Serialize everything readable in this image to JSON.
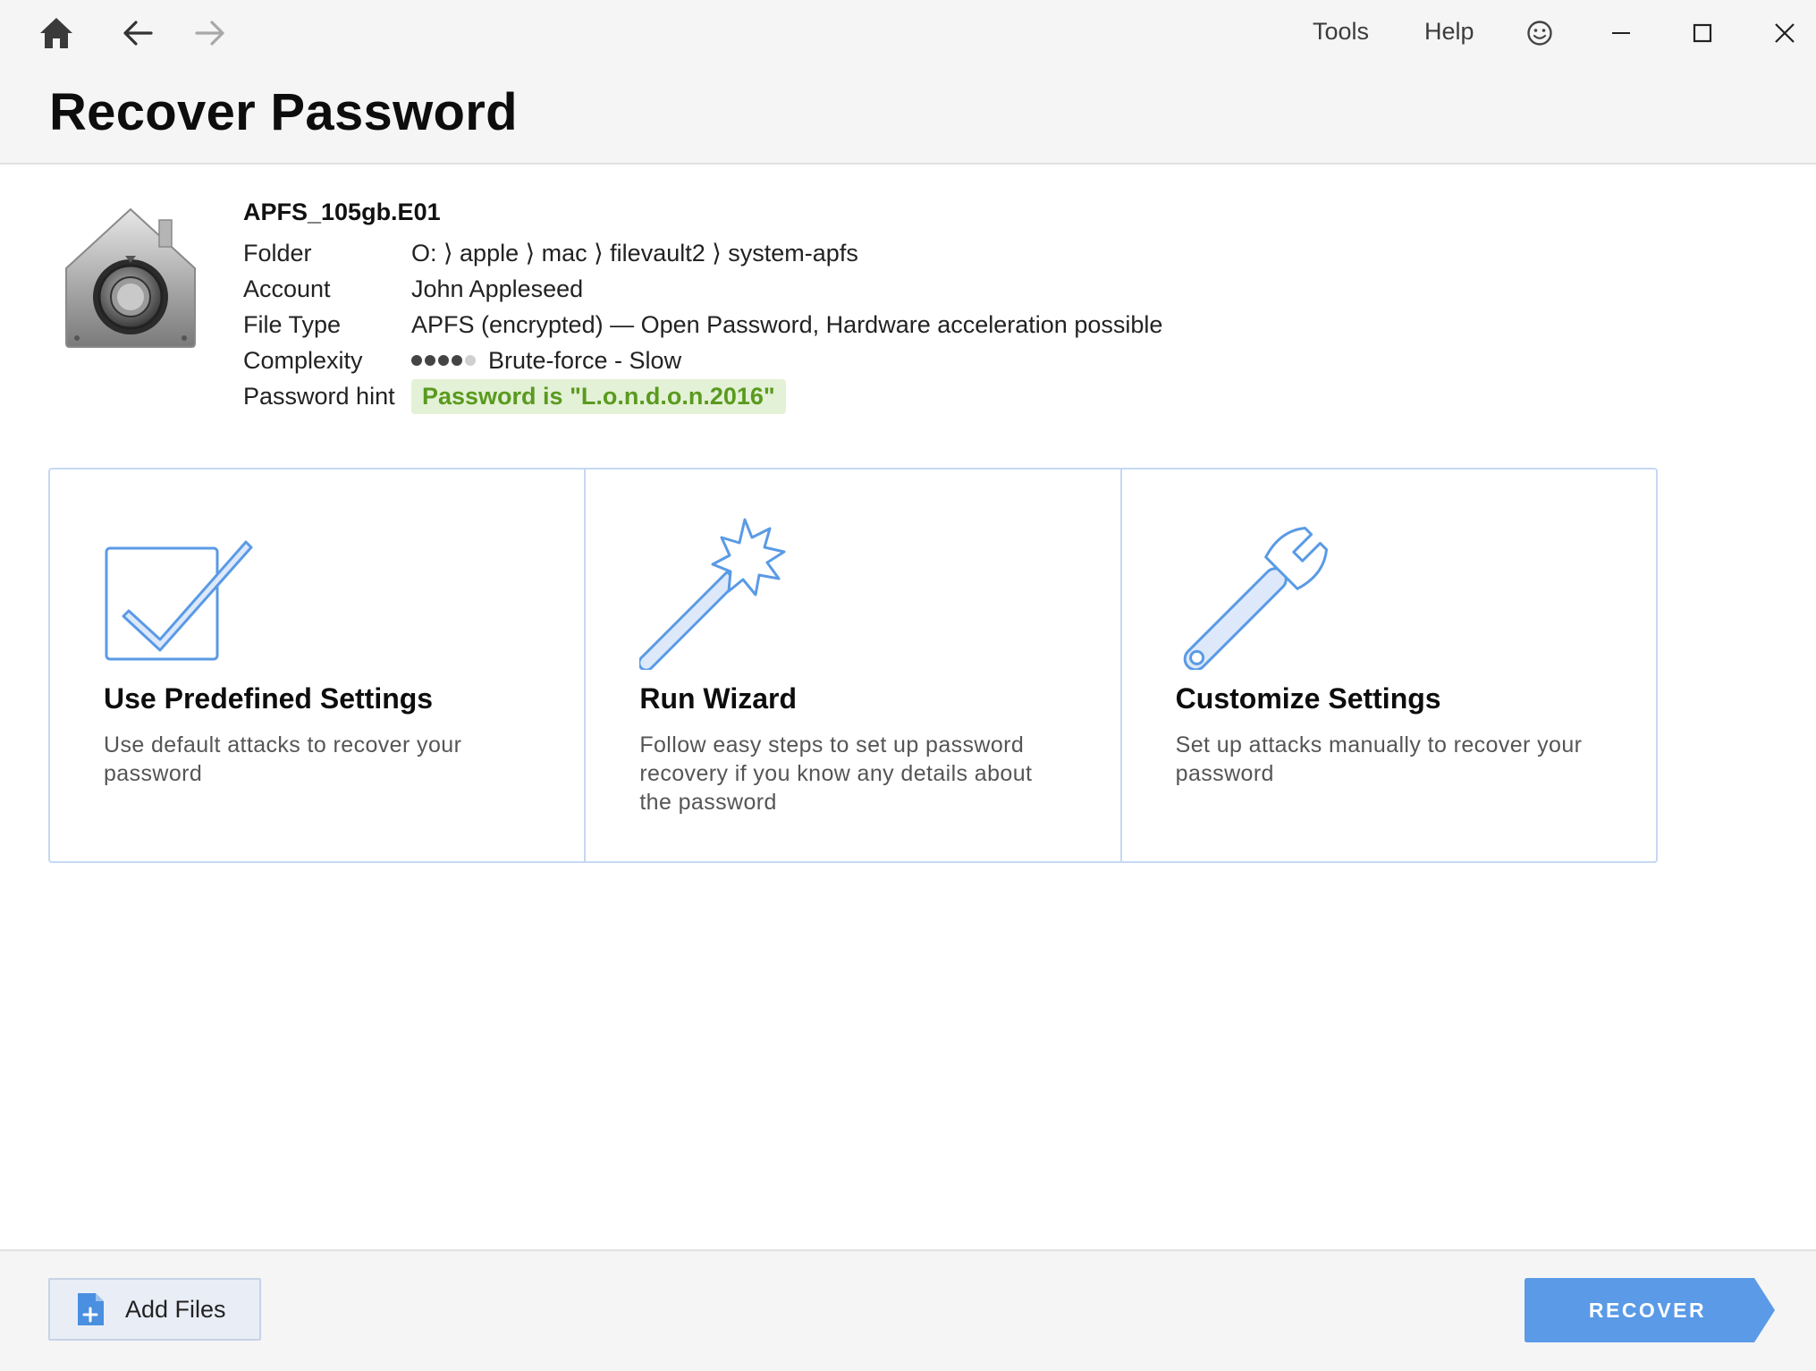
{
  "toolbar": {
    "home_icon": "home-icon",
    "back_icon": "arrow-left-icon",
    "forward_icon": "arrow-right-icon",
    "menu": {
      "tools": "Tools",
      "help": "Help"
    },
    "feedback_icon": "smiley-icon",
    "window_controls": [
      "minimize-icon",
      "maximize-icon",
      "close-icon"
    ]
  },
  "page": {
    "title": "Recover Password"
  },
  "file": {
    "name": "APFS_105gb.E01",
    "icon": "filevault-lock-icon",
    "details": [
      {
        "label": "Folder",
        "value": "O: ⟩ apple ⟩ mac ⟩ filevault2 ⟩ system-apfs"
      },
      {
        "label": "Account",
        "value": "John Appleseed"
      },
      {
        "label": "File Type",
        "value": "APFS (encrypted) — Open Password, Hardware acceleration possible"
      },
      {
        "label": "Complexity",
        "value": "Brute-force - Slow",
        "level": 4,
        "max_level": 5
      },
      {
        "label": "Password hint",
        "value": "Password is \"L.o.n.d.o.n.2016\""
      }
    ]
  },
  "options": [
    {
      "icon": "checkbox-checked-icon",
      "title": "Use Predefined Settings",
      "description": "Use default attacks to recover your password"
    },
    {
      "icon": "magic-wand-icon",
      "title": "Run Wizard",
      "description": "Follow easy steps to set up password recovery if you know any details about the password"
    },
    {
      "icon": "wrench-icon",
      "title": "Customize Settings",
      "description": "Set up attacks manually to recover your password"
    }
  ],
  "footer": {
    "add_files_icon": "add-file-icon",
    "add_files_label": "Add Files",
    "recover_label": "RECOVER"
  },
  "colors": {
    "accent_blue": "#5a9ae6",
    "option_border": "#c5d8f3",
    "hint_bg": "#e3f1d6",
    "hint_text": "#5a9a1f",
    "header_bg": "#f5f5f5"
  }
}
